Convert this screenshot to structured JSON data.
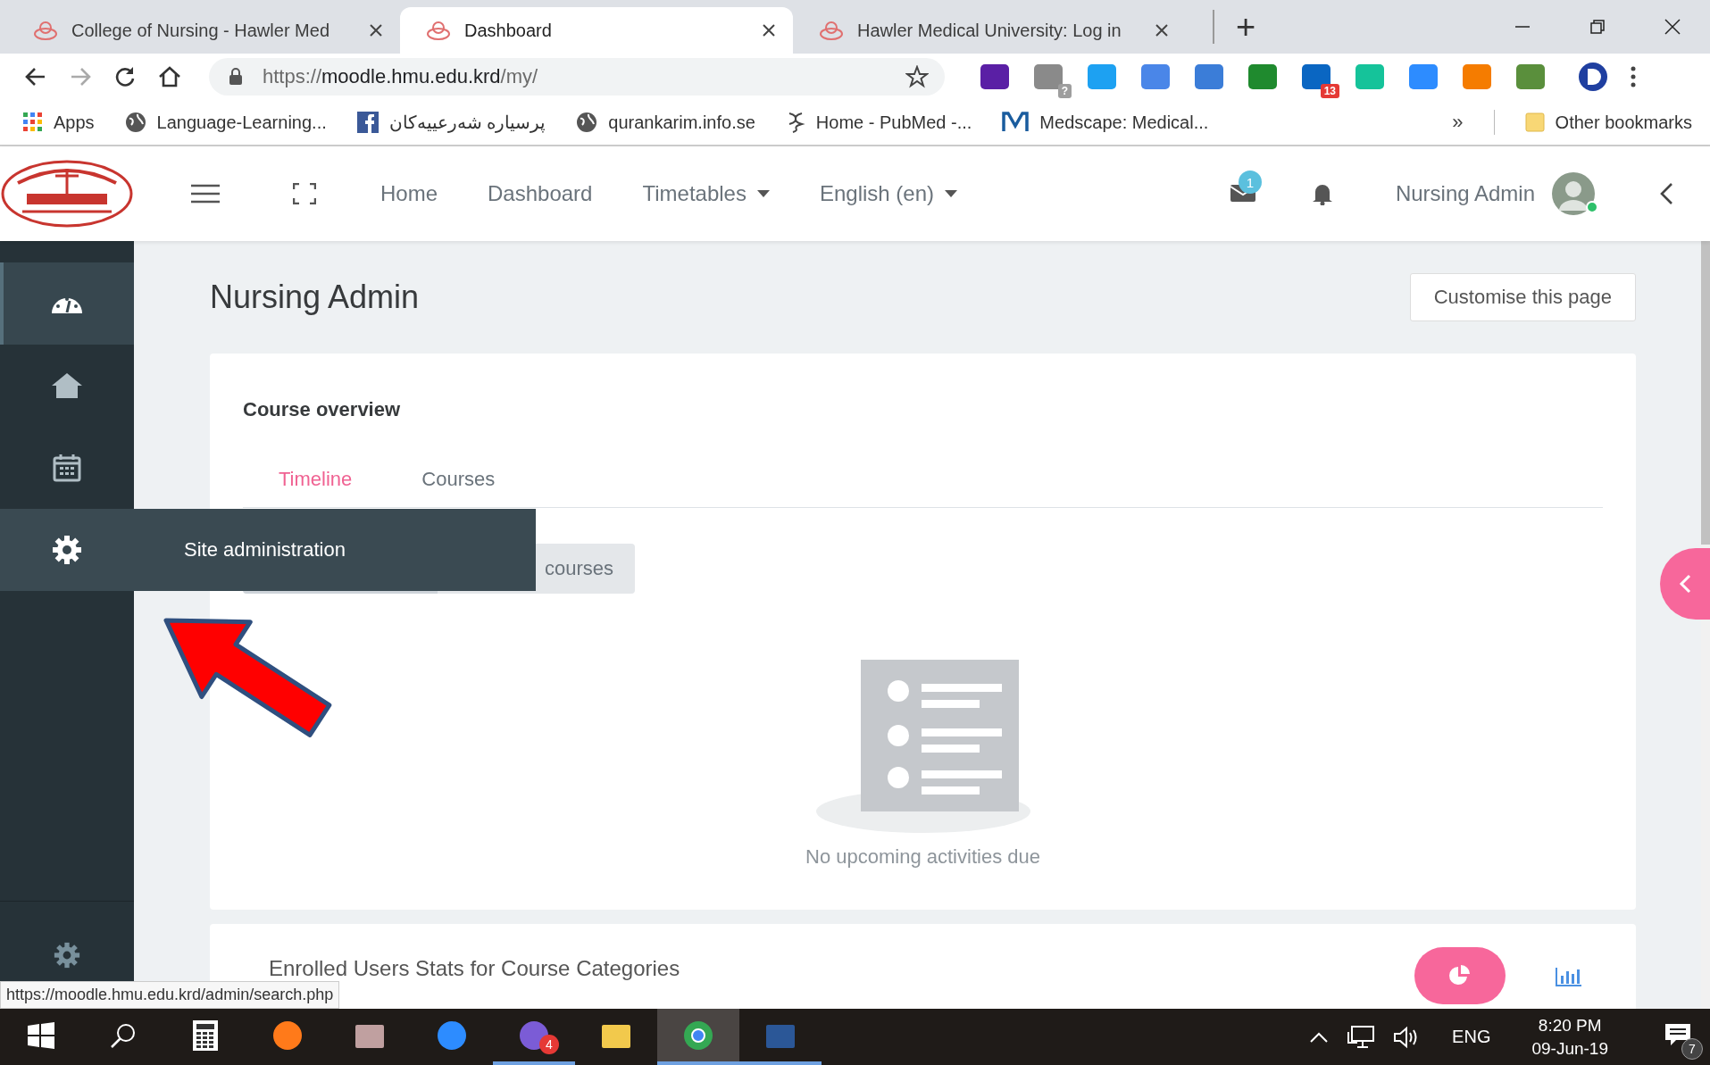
{
  "browser": {
    "tabs": [
      {
        "title": "College of Nursing - Hawler Med",
        "selected": false
      },
      {
        "title": "Dashboard",
        "selected": true
      },
      {
        "title": "Hawler Medical University: Log in",
        "selected": false
      }
    ],
    "new_tab": "+",
    "address": {
      "scheme": "https://",
      "host": "moodle.hmu.edu.krd",
      "path": "/my/"
    },
    "extensions": [
      {
        "kind": "mail"
      },
      {
        "kind": "envelope",
        "badge": "?"
      },
      {
        "kind": "bird"
      },
      {
        "kind": "translate"
      },
      {
        "kind": "cap"
      },
      {
        "kind": "torrent"
      },
      {
        "kind": "in",
        "badge": "13"
      },
      {
        "kind": "grammar"
      },
      {
        "kind": "video"
      },
      {
        "kind": "chart"
      },
      {
        "kind": "globe"
      }
    ],
    "bookmarks": [
      {
        "kind": "apps",
        "label": "Apps"
      },
      {
        "kind": "globe",
        "label": "Language-Learning..."
      },
      {
        "kind": "f",
        "label": "پرسیارە شەرعییەکان"
      },
      {
        "kind": "globe",
        "label": "qurankarim.info.se"
      },
      {
        "kind": "helix",
        "label": "Home - PubMed -..."
      },
      {
        "kind": "m",
        "label": "Medscape: Medical..."
      }
    ],
    "bookmarks_overflow": "»",
    "other_bookmarks": "Other bookmarks"
  },
  "header": {
    "nav": [
      {
        "label": "Home",
        "dropdown": false
      },
      {
        "label": "Dashboard",
        "dropdown": false
      },
      {
        "label": "Timetables",
        "dropdown": true
      },
      {
        "label": "English (en)",
        "dropdown": true
      }
    ],
    "messages_badge": "1",
    "user_name": "Nursing Admin"
  },
  "sidebar": {
    "items": [
      {
        "kind": "dashboard",
        "selected": true,
        "hovered": false
      },
      {
        "kind": "home",
        "selected": false,
        "hovered": false
      },
      {
        "kind": "calendar",
        "selected": false,
        "hovered": false
      },
      {
        "kind": "settings",
        "selected": false,
        "hovered": true,
        "flyout": "Site administration"
      }
    ]
  },
  "page_title": "Nursing Admin",
  "customise_button": "Customise this page",
  "overview": {
    "heading": "Course overview",
    "tabs": [
      {
        "label": "Timeline",
        "selected": true
      },
      {
        "label": "Courses",
        "selected": false
      }
    ],
    "filter_button": "courses",
    "empty_message": "No upcoming activities due"
  },
  "stats": {
    "title": "Enrolled Users Stats for Course Categories"
  },
  "status_url": "https://moodle.hmu.edu.krd/admin/search.php",
  "taskbar": {
    "apps": [
      {
        "kind": "windows",
        "running": false,
        "selected": false
      },
      {
        "kind": "search",
        "running": false,
        "selected": false
      },
      {
        "kind": "calculator",
        "running": false,
        "selected": false
      },
      {
        "kind": "firefox",
        "running": false,
        "selected": false
      },
      {
        "kind": "math",
        "running": false,
        "selected": false
      },
      {
        "kind": "video",
        "running": false,
        "selected": false
      },
      {
        "kind": "phone",
        "running": true,
        "selected": false,
        "badge": "4"
      },
      {
        "kind": "folder",
        "running": false,
        "selected": false
      },
      {
        "kind": "chrome",
        "running": true,
        "selected": true
      },
      {
        "kind": "word",
        "running": true,
        "selected": false
      }
    ],
    "language": "ENG",
    "time": "8:20 PM",
    "date": "09-Jun-19",
    "notifications": "7"
  }
}
